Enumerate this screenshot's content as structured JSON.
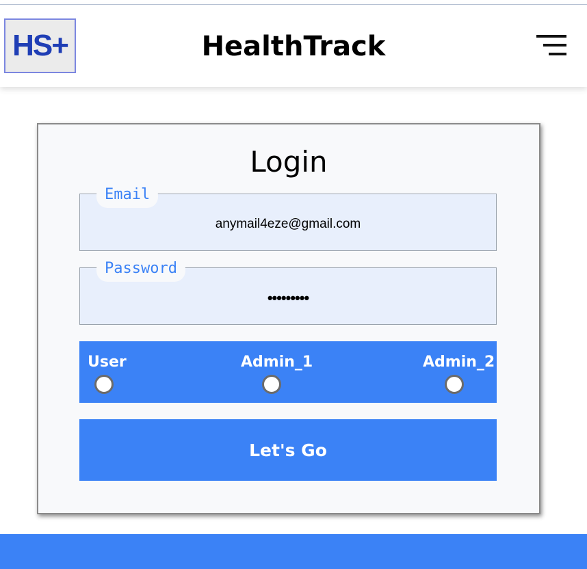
{
  "header": {
    "logo_text": "HS+",
    "title": "HealthTrack",
    "menu_icon": "hamburger-menu-icon"
  },
  "login": {
    "title": "Login",
    "email": {
      "label": "Email",
      "value": "anymail4eze@gmail.com"
    },
    "password": {
      "label": "Password",
      "value": "•••••••••"
    },
    "roles": [
      {
        "label": "User"
      },
      {
        "label": "Admin_1"
      },
      {
        "label": "Admin_2"
      }
    ],
    "submit_label": "Let's Go"
  },
  "colors": {
    "accent": "#3b82f6",
    "logo": "#1f3eb5"
  }
}
